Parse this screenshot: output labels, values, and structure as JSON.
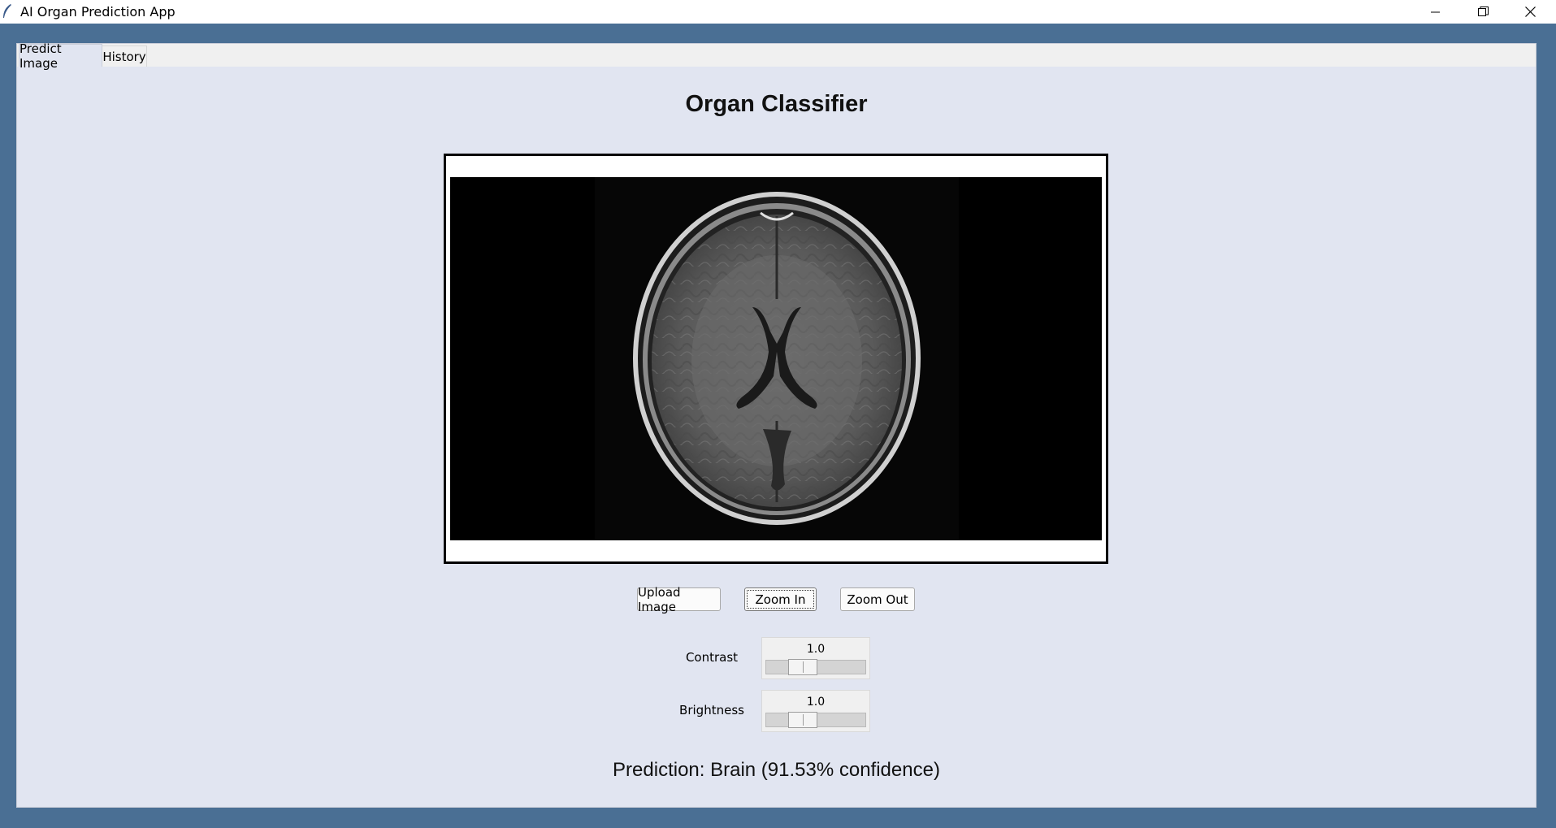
{
  "window": {
    "title": "AI Organ Prediction App",
    "minimize_icon": "minimize-icon",
    "restore_icon": "restore-icon",
    "close_icon": "close-icon"
  },
  "tabs": [
    {
      "label": "Predict Image",
      "active": true
    },
    {
      "label": "History",
      "active": false
    }
  ],
  "main": {
    "heading": "Organ Classifier",
    "image_preview": {
      "content": "axial brain MRI scan",
      "background": "#000000"
    },
    "buttons": {
      "upload": "Upload Image",
      "zoom_in": "Zoom In",
      "zoom_out": "Zoom Out"
    },
    "contrast": {
      "label": "Contrast",
      "value": "1.0"
    },
    "brightness": {
      "label": "Brightness",
      "value": "1.0"
    },
    "prediction": "Prediction: Brain (91.53% confidence)"
  },
  "colors": {
    "desktop": "#4a6f94",
    "frame_background": "#e1e5f1",
    "title_bar": "#ffffff"
  }
}
